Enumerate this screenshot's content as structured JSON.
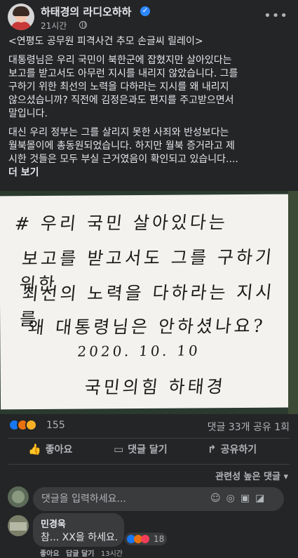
{
  "post": {
    "page_name": "하태경의 라디오하하",
    "time": "21시간",
    "paragraphs": [
      "<연평도 공무원 피격사건 추모 손글씨 릴레이>",
      "대통령님은 우리 국민이 북한군에 잡혔지만 살아있다는\n보고를 받고서도 아무런 지시를 내리지 않았습니다. 그를\n구하기 위한 최선의 노력을 다하라는 지시를 왜 내리지\n않으셨습니까? 직전에 김정은과도 편지를 주고받으면서\n말입니다.",
      "대신 우리 정부는 그를 살리지 못한 사죄와 반성보다는\n월북몰이에 총동원되었습니다. 하지만 월북 증거라고 제\n시한 것들은 모두 부실 근거였음이 확인되고 있습니다...."
    ],
    "see_more": "더 보기"
  },
  "photo": {
    "handwriting": [
      "# 우리 국민 살아있다는",
      "보고를 받고서도 그를 구하기 위한",
      "최선의 노력을 다하라는 지시를",
      "왜 대통령님은 안하셨나요?",
      "2020. 10. 10",
      "국민의힘 하태경"
    ]
  },
  "stats": {
    "reaction_count": "155",
    "comments_shares": "댓글 33개 공유 1회"
  },
  "actions": {
    "like": "좋아요",
    "comment": "댓글 달기",
    "share": "공유하기"
  },
  "comments_sort": "관련성 높은 댓글",
  "comment_input": {
    "placeholder": "댓글을 입력하세요..."
  },
  "comment": {
    "author": "민경욱",
    "text": "참... XX을 하세요.",
    "reaction_count": "18",
    "like": "좋아요",
    "reply": "답글 달기",
    "time": "13시간"
  },
  "colors": {
    "background": "#242526",
    "text": "#e4e6eb",
    "secondary": "#b0b3b8",
    "like_blue": "#1877f2"
  }
}
